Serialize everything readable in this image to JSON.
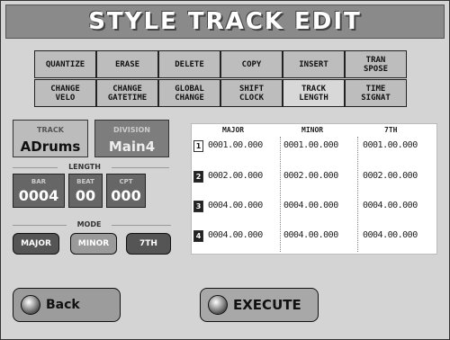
{
  "title": "STYLE TRACK EDIT",
  "functions": [
    {
      "label": "QUANTIZE"
    },
    {
      "label": "ERASE"
    },
    {
      "label": "DELETE"
    },
    {
      "label": "COPY"
    },
    {
      "label": "INSERT"
    },
    {
      "label": "TRAN\nSPOSE"
    },
    {
      "label": "CHANGE\nVELO"
    },
    {
      "label": "CHANGE\nGATETIME"
    },
    {
      "label": "GLOBAL\nCHANGE"
    },
    {
      "label": "SHIFT\nCLOCK"
    },
    {
      "label": "TRACK\nLENGTH"
    },
    {
      "label": "TIME\nSIGNAT"
    }
  ],
  "track": {
    "caption": "TRACK",
    "value": "ADrums"
  },
  "division": {
    "caption": "DIVISION",
    "value": "Main4"
  },
  "length": {
    "label": "LENGTH",
    "bar": {
      "caption": "BAR",
      "value": "0004"
    },
    "beat": {
      "caption": "BEAT",
      "value": "00"
    },
    "cpt": {
      "caption": "CPT",
      "value": "000"
    }
  },
  "mode": {
    "label": "MODE",
    "buttons": [
      "MAJOR",
      "MINOR",
      "7TH"
    ]
  },
  "table": {
    "headers": [
      "MAJOR",
      "MINOR",
      "7TH"
    ],
    "rows": [
      {
        "index": "1",
        "major": "0001.00.000",
        "minor": "0001.00.000",
        "seventh": "0001.00.000"
      },
      {
        "index": "2",
        "major": "0002.00.000",
        "minor": "0002.00.000",
        "seventh": "0002.00.000"
      },
      {
        "index": "3",
        "major": "0004.00.000",
        "minor": "0004.00.000",
        "seventh": "0004.00.000"
      },
      {
        "index": "4",
        "major": "0004.00.000",
        "minor": "0004.00.000",
        "seventh": "0004.00.000"
      }
    ]
  },
  "back_label": "Back",
  "execute_label": "EXECUTE"
}
